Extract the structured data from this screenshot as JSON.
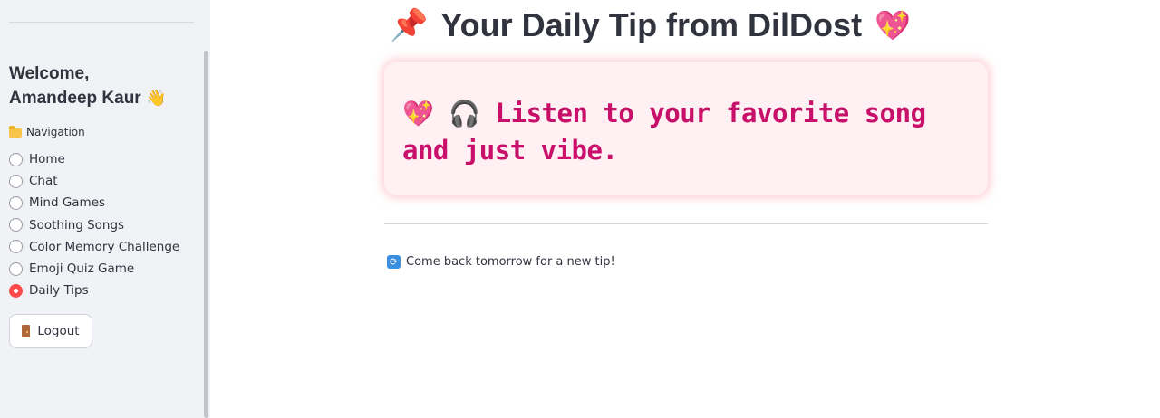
{
  "sidebar": {
    "welcome_line1": "Welcome,",
    "welcome_name": "Amandeep Kaur",
    "welcome_emoji": "👋",
    "nav_label": "Navigation",
    "nav_items": [
      {
        "label": "Home",
        "selected": false
      },
      {
        "label": "Chat",
        "selected": false
      },
      {
        "label": "Mind Games",
        "selected": false
      },
      {
        "label": "Soothing Songs",
        "selected": false
      },
      {
        "label": "Color Memory Challenge",
        "selected": false
      },
      {
        "label": "Emoji Quiz Game",
        "selected": false
      },
      {
        "label": "Daily Tips",
        "selected": true
      }
    ],
    "logout_label": "Logout"
  },
  "main": {
    "title": "Your Daily Tip from DilDost",
    "title_prefix_emoji": "📌",
    "title_suffix_emoji": "💖",
    "tip_heart": "💖",
    "tip_headphones": "🎧",
    "tip_text": "Listen to your favorite song and just vibe.",
    "note_icon": "🔁",
    "note_text": "Come back tomorrow for a new tip!"
  },
  "colors": {
    "sidebar_bg": "#f0f2f6",
    "accent_radio": "#ff4b4b",
    "tip_card_bg": "#fff0f3",
    "tip_text": "#c8106a",
    "text": "#31333f"
  }
}
